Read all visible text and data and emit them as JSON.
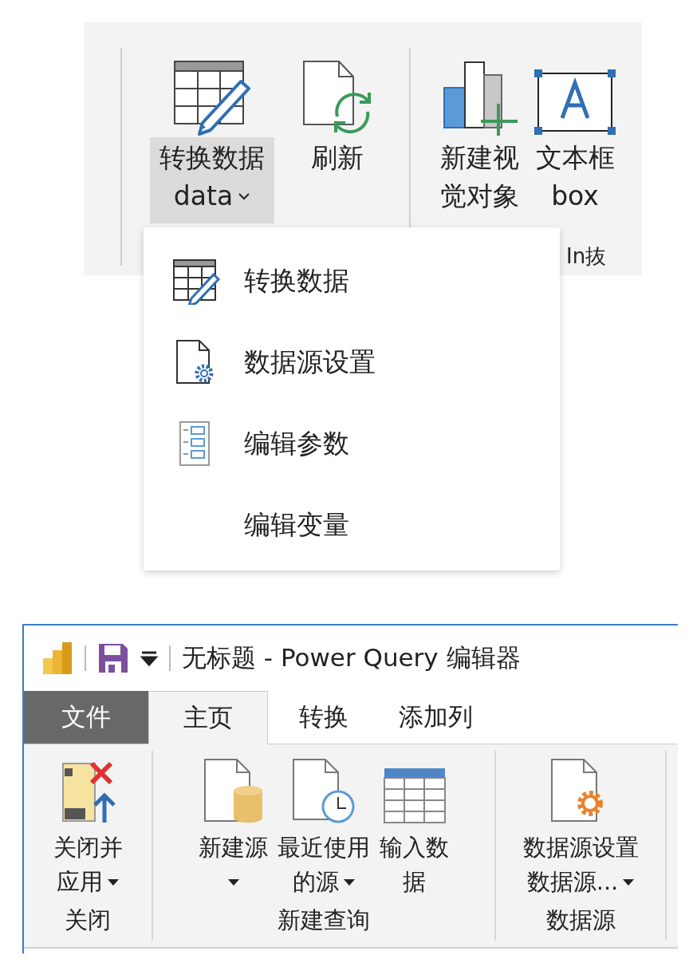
{
  "ribbon": {
    "buttons": [
      {
        "kind": "transform",
        "lines": [
          "转换数据",
          "data"
        ],
        "chevron": true,
        "selected": true
      },
      {
        "kind": "refresh",
        "lines": [
          "刷新"
        ],
        "chevron": false,
        "selected": false
      },
      {
        "kind": "visual",
        "lines": [
          "新建视",
          "觉对象"
        ],
        "chevron": false,
        "selected": false
      },
      {
        "kind": "textbox",
        "lines": [
          "文本框",
          "box"
        ],
        "chevron": false,
        "selected": false
      }
    ],
    "group_label": "In抜"
  },
  "menu": {
    "items": [
      {
        "kind": "table-edit",
        "label": "转换数据"
      },
      {
        "kind": "doc-gear",
        "label": "数据源设置"
      },
      {
        "kind": "params",
        "label": "编辑参数"
      },
      {
        "kind": "plain",
        "label": "编辑变量"
      }
    ]
  },
  "editor": {
    "title": "无标题 - Power Query 编辑器",
    "tabs": [
      {
        "label": "文件",
        "kind": "file",
        "selected": false
      },
      {
        "label": "主页",
        "kind": "tab",
        "selected": true
      },
      {
        "label": "转换",
        "kind": "tab",
        "selected": false
      },
      {
        "label": "添加列",
        "kind": "tab",
        "selected": false
      }
    ],
    "groups": [
      {
        "label": "关闭",
        "buttons": [
          {
            "kind": "close-apply",
            "lines": [
              "关闭并",
              "应用"
            ],
            "dropdown": true
          }
        ]
      },
      {
        "label": "新建查询",
        "buttons": [
          {
            "kind": "new-source",
            "lines": [
              "新建源"
            ],
            "dropdown": true
          },
          {
            "kind": "recent",
            "lines": [
              "最近使用",
              "的源"
            ],
            "dropdown": true
          },
          {
            "kind": "enter-data",
            "lines": [
              "输入数",
              "据"
            ],
            "dropdown": false
          }
        ]
      },
      {
        "label": "数据源",
        "buttons": [
          {
            "kind": "ds-settings",
            "lines": [
              "数据源设置",
              "数据源..."
            ],
            "dropdown": true
          }
        ]
      }
    ]
  }
}
